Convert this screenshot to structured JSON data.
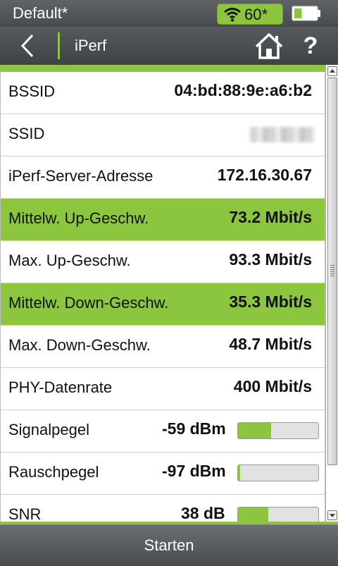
{
  "status": {
    "profile": "Default*",
    "wifi_value": "60*",
    "battery_level": 0.35
  },
  "nav": {
    "title": "iPerf",
    "help": "?"
  },
  "rows": [
    {
      "label": "BSSID",
      "value": "04:bd:88:9e:a6:b2"
    },
    {
      "label": "SSID",
      "value": ""
    },
    {
      "label": "iPerf-Server-Adresse",
      "value": "172.16.30.67"
    },
    {
      "label": "Mittelw. Up-Geschw.",
      "value": "73.2 Mbit/s"
    },
    {
      "label": "Max. Up-Geschw.",
      "value": "93.3 Mbit/s"
    },
    {
      "label": "Mittelw. Down-Geschw.",
      "value": "35.3 Mbit/s"
    },
    {
      "label": "Max. Down-Geschw.",
      "value": "48.7 Mbit/s"
    },
    {
      "label": "PHY-Datenrate",
      "value": "400 Mbit/s"
    },
    {
      "label": "Signalpegel",
      "value": "-59 dBm",
      "level": 0.41
    },
    {
      "label": "Rauschpegel",
      "value": "-97 dBm",
      "level": 0.03
    },
    {
      "label": "SNR",
      "value": "38 dB",
      "level": 0.38
    }
  ],
  "colors": {
    "accent": "#8cc63f",
    "background": "#4a4d50"
  },
  "footer": {
    "start_label": "Starten"
  }
}
